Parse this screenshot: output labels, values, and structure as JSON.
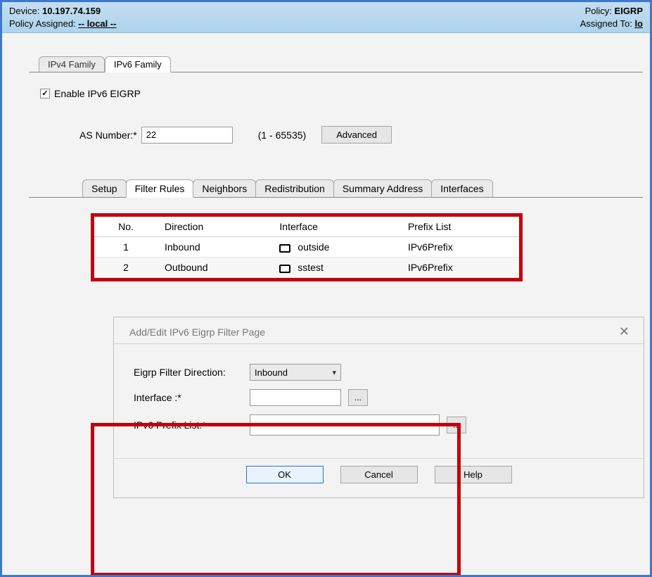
{
  "header": {
    "device_label": "Device:",
    "device_value": "10.197.74.159",
    "policy_assigned_label": "Policy Assigned:",
    "policy_assigned_value": "-- local --",
    "policy_label": "Policy:",
    "policy_value": "EIGRP",
    "assigned_to_label": "Assigned To:",
    "assigned_to_value": "lo"
  },
  "top_tabs": {
    "ipv4": "IPv4 Family",
    "ipv6": "IPv6 Family"
  },
  "enable_label": "Enable IPv6 EIGRP",
  "as": {
    "label": "AS Number:*",
    "value": "22",
    "range": "(1 - 65535)",
    "advanced": "Advanced"
  },
  "inner_tabs": [
    "Setup",
    "Filter Rules",
    "Neighbors",
    "Redistribution",
    "Summary Address",
    "Interfaces"
  ],
  "table": {
    "headers": [
      "No.",
      "Direction",
      "Interface",
      "Prefix List"
    ],
    "rows": [
      {
        "no": "1",
        "direction": "Inbound",
        "interface": "outside",
        "prefix": "IPv6Prefix"
      },
      {
        "no": "2",
        "direction": "Outbound",
        "interface": "sstest",
        "prefix": "IPv6Prefix"
      }
    ]
  },
  "dialog": {
    "title": "Add/Edit IPv6 Eigrp Filter Page",
    "direction_label": "Eigrp Filter Direction:",
    "direction_value": "Inbound",
    "interface_label": "Interface :*",
    "interface_value": "",
    "prefix_label": "IPv6 Prefix List:*",
    "prefix_value": "",
    "browse": "...",
    "ok": "OK",
    "cancel": "Cancel",
    "help": "Help"
  }
}
